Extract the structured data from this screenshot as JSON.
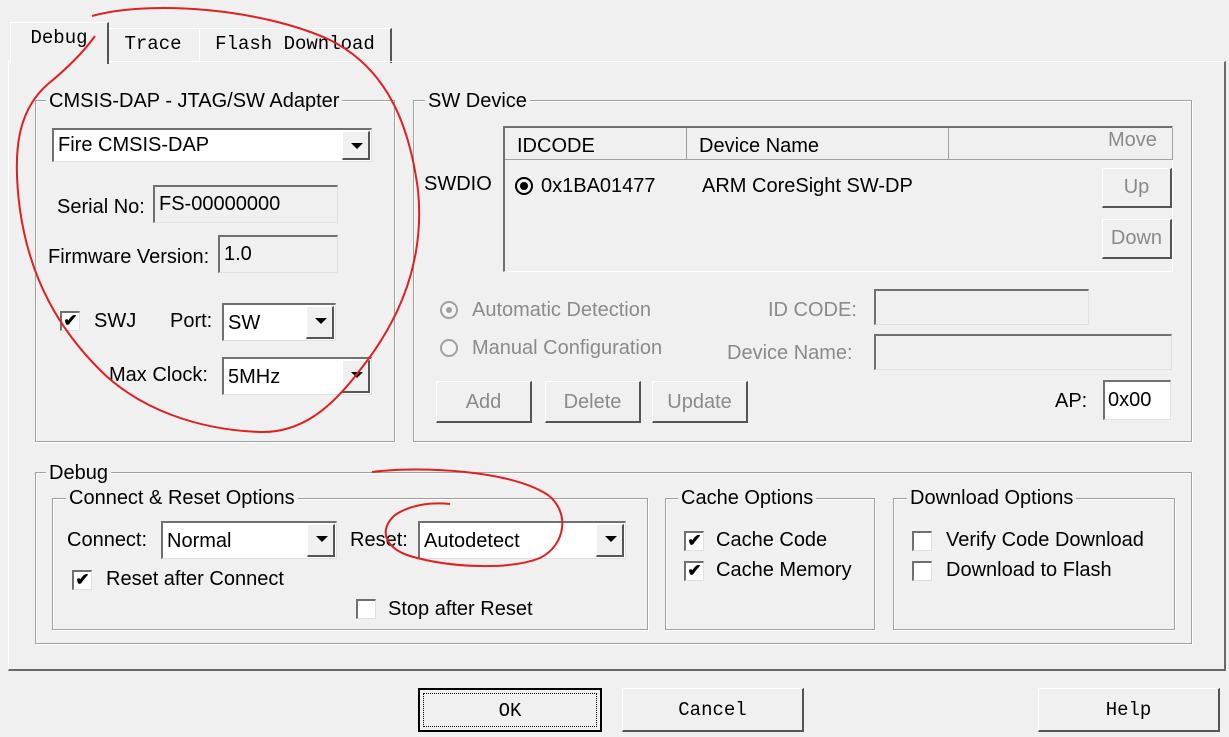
{
  "tabs": [
    {
      "label": "Debug",
      "active": true
    },
    {
      "label": "Trace",
      "active": false
    },
    {
      "label": "Flash Download",
      "active": false
    }
  ],
  "adapter": {
    "legend": "CMSIS-DAP - JTAG/SW Adapter",
    "selected": "Fire CMSIS-DAP",
    "serial_label": "Serial No:",
    "serial_value": "FS-00000000",
    "firmware_label": "Firmware Version:",
    "firmware_value": "1.0",
    "swj_label": "SWJ",
    "swj_checked": true,
    "port_label": "Port:",
    "port_value": "SW",
    "clock_label": "Max Clock:",
    "clock_value": "5MHz"
  },
  "sw_device": {
    "legend": "SW Device",
    "side_label": "SWDIO",
    "columns": [
      "IDCODE",
      "Device Name",
      ""
    ],
    "rows": [
      {
        "idcode": "0x1BA01477",
        "name": "ARM CoreSight SW-DP"
      }
    ],
    "move_label": "Move",
    "up_label": "Up",
    "down_label": "Down",
    "auto_detect": "Automatic Detection",
    "manual_config": "Manual Configuration",
    "idcode_label": "ID CODE:",
    "device_name_label": "Device Name:",
    "add_label": "Add",
    "delete_label": "Delete",
    "update_label": "Update",
    "ap_label": "AP:",
    "ap_value": "0x00"
  },
  "debug": {
    "legend": "Debug",
    "connect_reset": {
      "legend": "Connect & Reset Options",
      "connect_label": "Connect:",
      "connect_value": "Normal",
      "reset_label": "Reset:",
      "reset_value": "Autodetect",
      "reset_after_connect": "Reset after Connect",
      "stop_after_reset": "Stop after Reset"
    },
    "cache": {
      "legend": "Cache Options",
      "cache_code": "Cache Code",
      "cache_memory": "Cache Memory"
    },
    "download": {
      "legend": "Download Options",
      "verify": "Verify Code Download",
      "to_flash": "Download to Flash"
    }
  },
  "footer": {
    "ok": "OK",
    "cancel": "Cancel",
    "help": "Help"
  },
  "colors": {
    "annotation": "#e02020",
    "face": "#f0f0f0"
  }
}
